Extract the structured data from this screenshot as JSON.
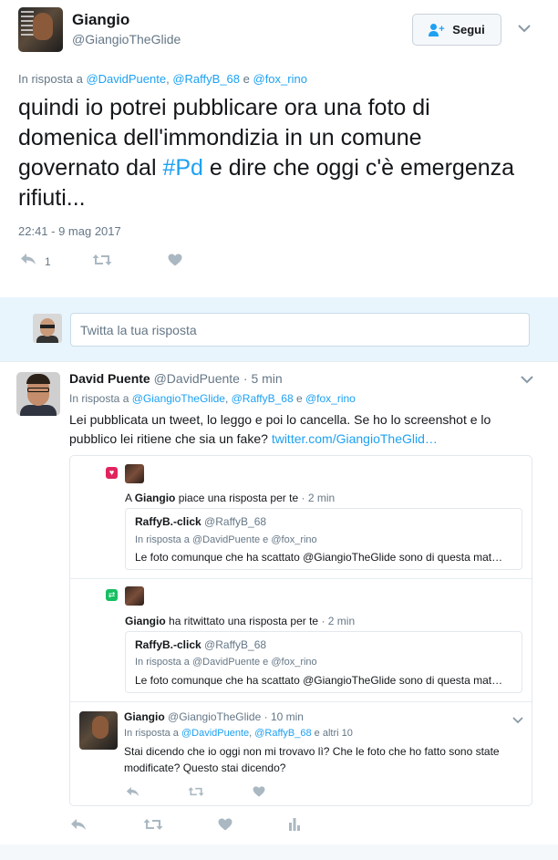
{
  "main_tweet": {
    "author_name": "Giangio",
    "author_handle": "@GiangioTheGlide",
    "follow_label": "Segui",
    "reply_prefix": "In risposta a",
    "reply_to": [
      "@DavidPuente",
      "@RaffyB_68",
      "@fox_rino"
    ],
    "reply_comma": ",",
    "reply_and": "e",
    "text_part1": "quindi io potrei pubblicare ora una foto di domenica dell'immondizia in un comune governato dal ",
    "hashtag": "#Pd",
    "text_part2": " e dire che oggi c'è emergenza rifiuti...",
    "timestamp": "22:41 - 9 mag 2017",
    "reply_count": "1"
  },
  "compose": {
    "placeholder": "Twitta la tua risposta"
  },
  "reply_tweet": {
    "author_name": "David Puente",
    "author_handle": "@DavidPuente",
    "dot": "·",
    "time": "5 min",
    "reply_prefix": "In risposta a",
    "reply_to": [
      "@GiangioTheGlide",
      "@RaffyB_68",
      "@fox_rino"
    ],
    "text": "Lei pubblicata un tweet, lo leggo e poi lo cancella. Se ho lo screenshot e lo pubblico lei ritiene che sia un fake? ",
    "link": "twitter.com/GiangioTheGlid…"
  },
  "activity": [
    {
      "prefix": "A",
      "actor": "Giangio",
      "action": "piace una risposta per te",
      "time": "2 min",
      "quote_name": "RaffyB.-click",
      "quote_handle": "@RaffyB_68",
      "quote_reply": "In risposta a @DavidPuente e @fox_rino",
      "quote_text": "Le foto comunque che ha scattato @GiangioTheGlide sono di questa mat…"
    },
    {
      "actor": "Giangio",
      "action": "ha ritwittato una risposta per te",
      "time": "2 min",
      "quote_name": "RaffyB.-click",
      "quote_handle": "@RaffyB_68",
      "quote_reply": "In risposta a @DavidPuente e @fox_rino",
      "quote_text": "Le foto comunque che ha scattato @GiangioTheGlide sono di questa mat…"
    }
  ],
  "nested_reply": {
    "author_name": "Giangio",
    "author_handle": "@GiangioTheGlide",
    "time": "10 min",
    "reply_prefix": "In risposta a",
    "reply_to": [
      "@DavidPuente",
      "@RaffyB_68"
    ],
    "reply_more": "e altri 10",
    "text": "Stai dicendo che io oggi non mi trovavo lì? Che le foto che ho fatto sono state modificate? Questo stai dicendo?"
  },
  "icons": {
    "reply": "reply-icon",
    "retweet": "retweet-icon",
    "like": "heart-icon",
    "analytics": "analytics-icon",
    "caret": "chevron-down-icon",
    "follow": "follow-user-icon"
  },
  "colors": {
    "link": "#1da1f2",
    "muted": "#657786",
    "like_badge": "#e0245e",
    "retweet_badge": "#17bf63",
    "compose_bg": "#e8f5fd"
  }
}
